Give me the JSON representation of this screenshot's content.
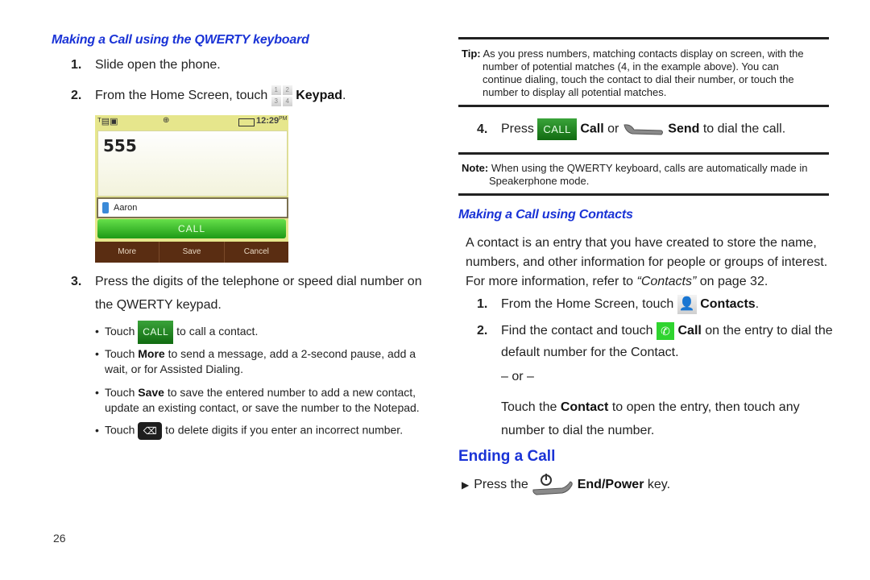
{
  "left": {
    "section_title": "Making a Call using the QWERTY keyboard",
    "step1": {
      "num": "1.",
      "text": "Slide open the phone."
    },
    "step2": {
      "num": "2.",
      "text_before": "From the Home Screen, touch",
      "bold": "Keypad",
      "text_after": ".",
      "keypad_icon_digits": [
        "1",
        "2",
        "3",
        "4"
      ]
    },
    "phone_screen": {
      "status_time": "12:29",
      "status_ampm": "PM",
      "dialed_number": "555",
      "contact_match": "Aaron",
      "call_label": "CALL",
      "softkeys": [
        "More",
        "Save",
        "Cancel"
      ]
    },
    "step3": {
      "num": "3.",
      "line1": "Press the digits of the telephone or speed dial number on",
      "line2": "the QWERTY keypad."
    },
    "bullets": {
      "b1": {
        "before": "Touch",
        "button": "CALL",
        "after": "to call a contact."
      },
      "b2": {
        "before": "Touch ",
        "bold": "More",
        "after": " to send a message, add a 2-second pause, add a",
        "line2": "wait, or for Assisted Dialing."
      },
      "b3": {
        "before": "Touch ",
        "bold": "Save",
        "after": " to save the entered number to add a new contact,",
        "line2": "update an existing contact, or save the number to the Notepad."
      },
      "b4": {
        "before": "Touch",
        "after": "to delete digits if you enter an incorrect number."
      }
    },
    "page_number": "26"
  },
  "right": {
    "tip": {
      "label": "Tip:",
      "line1": "As you press numbers, matching contacts display on screen, with the",
      "line2": "number of potential matches (4, in the example above). You can",
      "line3": "continue dialing, touch the contact to dial their number, or touch the",
      "line4": "number to display all potential matches."
    },
    "step4": {
      "num": "4.",
      "press": "Press",
      "button": "CALL",
      "bold_call": "Call",
      "or": "or",
      "bold_send": "Send",
      "after": "to dial the call."
    },
    "note": {
      "label": "Note:",
      "line1": "When using the QWERTY keyboard, calls are automatically made in",
      "line2": "Speakerphone mode."
    },
    "contacts_title": "Making a Call using Contacts",
    "contacts_para": {
      "line1": "A contact is an entry that you have created to store the name,",
      "line2": "numbers, and other information for people or groups of interest.",
      "line3_before": "For more information, refer to ",
      "line3_link": "“Contacts”",
      "line3_after": " on page 32."
    },
    "c_step1": {
      "num": "1.",
      "before": "From the Home Screen, touch",
      "bold": "Contacts",
      "after": "."
    },
    "c_step2": {
      "num": "2.",
      "before": "Find the contact and touch",
      "bold": "Call",
      "after": "on the entry to dial the",
      "line2": "default number for the Contact."
    },
    "or_separator": "– or –",
    "touch_contact": {
      "before": "Touch the ",
      "bold": "Contact",
      "after": " to open the entry, then touch any",
      "line2": "number to dial the number."
    },
    "ending": {
      "title": "Ending a Call",
      "arrow": "▶",
      "before": "Press the",
      "bold": "End/Power",
      "after": "key."
    }
  },
  "colors": {
    "heading_blue": "#1a33d6",
    "call_green": "#1d8a1d",
    "softkey_brown": "#5a2d12",
    "phone_bg": "#e6e68c"
  }
}
